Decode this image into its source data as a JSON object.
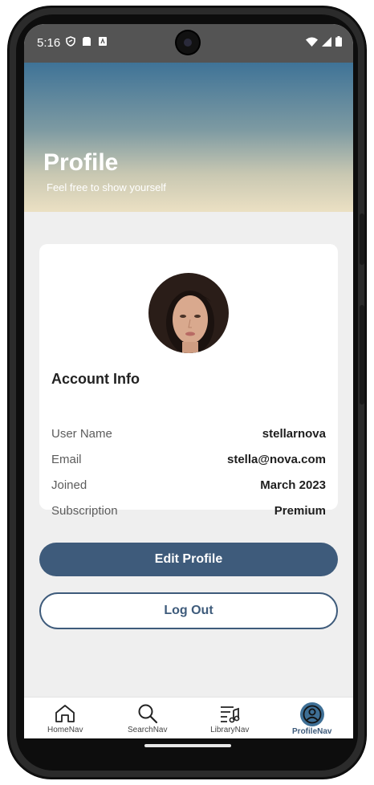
{
  "status_bar": {
    "time": "5:16",
    "left_icons": [
      "shield-icon",
      "sim-card-icon",
      "app-icon"
    ],
    "right_icons": [
      "wifi-icon",
      "signal-icon",
      "battery-icon"
    ]
  },
  "header": {
    "title": "Profile",
    "subtitle": "Feel free to show yourself",
    "gradient_colors": [
      "#3f7397",
      "#ebe0c3"
    ]
  },
  "account": {
    "heading": "Account Info",
    "rows": [
      {
        "label": "User Name",
        "value": "stellarnova"
      },
      {
        "label": "Email",
        "value": "stella@nova.com"
      },
      {
        "label": "Joined",
        "value": "March 2023"
      },
      {
        "label": "Subscription",
        "value": "Premium"
      }
    ]
  },
  "buttons": {
    "edit_profile": "Edit Profile",
    "log_out": "Log Out"
  },
  "bottom_nav": {
    "items": [
      {
        "label": "HomeNav",
        "icon": "home-icon",
        "active": false
      },
      {
        "label": "SearchNav",
        "icon": "search-icon",
        "active": false
      },
      {
        "label": "LibraryNav",
        "icon": "library-icon",
        "active": false
      },
      {
        "label": "ProfileNav",
        "icon": "profile-icon",
        "active": true
      }
    ]
  },
  "colors": {
    "accent": "#3e5b7b",
    "background": "#efefef"
  }
}
